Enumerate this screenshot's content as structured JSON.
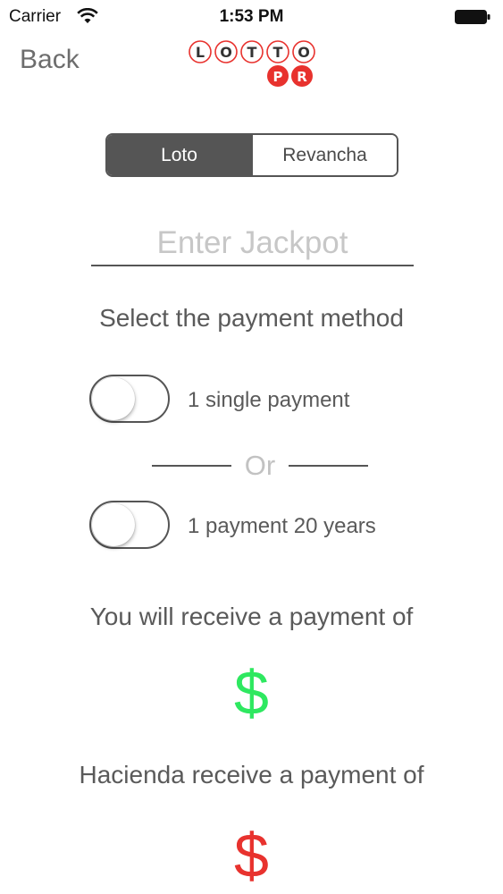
{
  "status_bar": {
    "carrier": "Carrier",
    "time": "1:53 PM"
  },
  "nav": {
    "back_label": "Back",
    "logo": {
      "letters": [
        "L",
        "O",
        "T",
        "T",
        "O"
      ],
      "badges": [
        "P",
        "R"
      ],
      "accent_color": "#e8322e"
    }
  },
  "tabs": [
    {
      "label": "Loto",
      "selected": true
    },
    {
      "label": "Revancha",
      "selected": false
    }
  ],
  "jackpot": {
    "placeholder": "Enter Jackpot",
    "value": ""
  },
  "payment": {
    "title": "Select the payment method",
    "options": [
      {
        "label": "1 single payment",
        "on": false
      },
      {
        "label": "1 payment 20 years",
        "on": false
      }
    ],
    "separator": "Or"
  },
  "results": {
    "receive_label": "You will receive a payment of",
    "receive_amount": "$",
    "receive_color": "#2ee860",
    "hacienda_label": "Hacienda receive a payment of",
    "hacienda_amount": "$",
    "hacienda_color": "#e8322e"
  }
}
